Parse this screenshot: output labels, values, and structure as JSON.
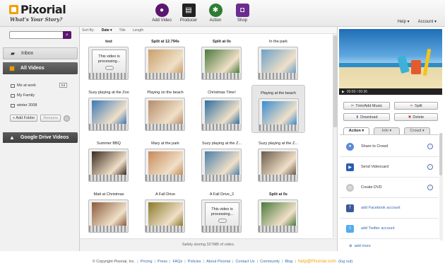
{
  "brand": {
    "name": "Pixorial",
    "tagline": "What's Your Story?"
  },
  "topnav": [
    {
      "label": "Add Video",
      "icon": "film-reel-add-icon",
      "color": "#5b1670"
    },
    {
      "label": "Producer",
      "icon": "clapperboard-icon",
      "color": "#222222"
    },
    {
      "label": "Action",
      "icon": "action-arrows-icon",
      "color": "#2e7d32"
    },
    {
      "label": "Shop",
      "icon": "shopping-bag-icon",
      "color": "#6a2c91"
    }
  ],
  "topright": {
    "help": "Help ▾",
    "account": "Account ▾"
  },
  "sidebar": {
    "search_placeholder": "",
    "inbox": "Inbox",
    "all_videos": "All Videos",
    "folders": [
      "Me at work",
      "My Family",
      "winter 2008"
    ],
    "folder_badge": "Ed",
    "add_folder": "+ Add Folder",
    "rename": "Rename",
    "google_drive": "Google Drive Videos"
  },
  "sortbar": {
    "label": "Sort By:",
    "selected": "Date ▾",
    "title": "Title",
    "length": "Length"
  },
  "videos": [
    {
      "title": "test",
      "processing": true,
      "bold": true
    },
    {
      "title": "Split at 12.794s",
      "bold": true,
      "color": "#c9a06a"
    },
    {
      "title": "Split at 0s",
      "bold": true,
      "color": "#4a7a3b"
    },
    {
      "title": "In the park",
      "color": "#6aa0c8"
    },
    {
      "title": "Suzy playing at the Zoo",
      "color": "#3b78b5"
    },
    {
      "title": "Playing on the beach",
      "color": "#b58c6a"
    },
    {
      "title": "Christmas Time!",
      "color": "#2e6e9e"
    },
    {
      "title": "Playing at the beach",
      "selected": true,
      "color": "#3a8ccf"
    },
    {
      "title": "Summer BBQ",
      "color": "#3a2a1f"
    },
    {
      "title": "Mary at the park",
      "color": "#c78a5a"
    },
    {
      "title": "Suzy playing at the Z...",
      "color": "#4b7fa8"
    },
    {
      "title": "Suzy playing at the Z...",
      "color": "#6a5a4a"
    },
    {
      "title": "Matt at Christmas",
      "color": "#8a5a3a"
    },
    {
      "title": "A Fall Drive",
      "color": "#8a7a2a"
    },
    {
      "title": "A Fall Drive_2",
      "processing": true
    },
    {
      "title": "Split at 0s",
      "bold": true,
      "color": "#4a7a3b"
    }
  ],
  "processing_text": "This video is processing...",
  "status": "Safely storing 327MB of video.",
  "player": {
    "time": "00:00 / 00:36"
  },
  "actions": {
    "trim": "Trim/Add Music",
    "split": "Split",
    "download": "Download",
    "delete": "Delete"
  },
  "tabs": [
    "Action ▾",
    "Info ▾",
    "Crowd ▾"
  ],
  "action_items": [
    {
      "label": "Share to Crowd",
      "icon": "crowd-icon",
      "link": false,
      "go": true
    },
    {
      "label": "Send Videocard",
      "icon": "videocard-icon",
      "link": false,
      "go": true
    },
    {
      "label": "Create DVD",
      "icon": "dvd-icon",
      "link": false,
      "go": true
    },
    {
      "label": "add Facebook account",
      "icon": "facebook-icon",
      "link": true,
      "go": false
    },
    {
      "label": "add Twitter account",
      "icon": "twitter-icon",
      "link": true,
      "go": false
    }
  ],
  "add_more": "add more",
  "footer": {
    "copyright": "© Copyright Pixorial, Inc.",
    "links": [
      "Pricing",
      "Press",
      "FAQs",
      "Policies",
      "About Pixorial",
      "Contact Us",
      "Community",
      "Blog"
    ],
    "email": "help@Pixorial.com",
    "logout": "(log out)"
  }
}
